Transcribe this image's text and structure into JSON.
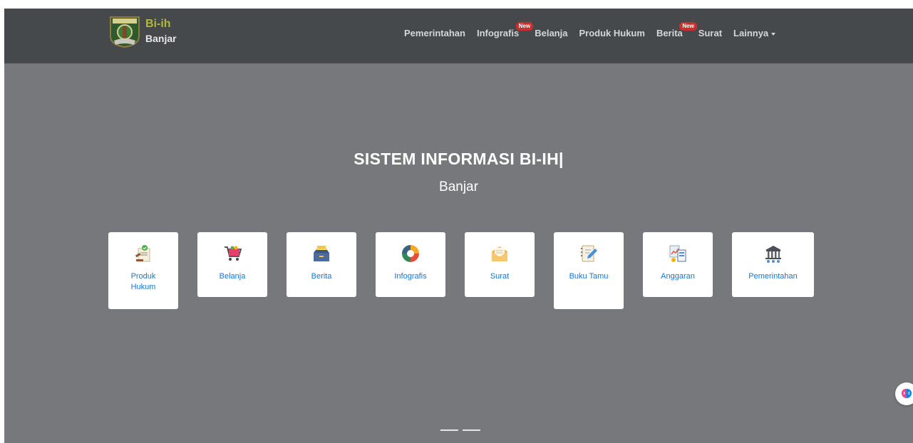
{
  "brand": {
    "name": "Bi-ih",
    "subtitle": "Banjar"
  },
  "nav": {
    "items": [
      {
        "label": "Pemerintahan"
      },
      {
        "label": "Infografis",
        "badge": "New"
      },
      {
        "label": "Belanja"
      },
      {
        "label": "Produk Hukum"
      },
      {
        "label": "Berita",
        "badge": "New"
      },
      {
        "label": "Surat"
      },
      {
        "label": "Lainnya"
      }
    ]
  },
  "hero": {
    "title": "SISTEM INFORMASI BI-IH|",
    "subtitle": "Banjar"
  },
  "cards": [
    {
      "label": "Produk Hukum",
      "icon": "law-document-icon"
    },
    {
      "label": "Belanja",
      "icon": "shopping-cart-icon"
    },
    {
      "label": "Berita",
      "icon": "news-inbox-icon"
    },
    {
      "label": "Infografis",
      "icon": "pie-chart-icon"
    },
    {
      "label": "Surat",
      "icon": "envelope-icon"
    },
    {
      "label": "Buku Tamu",
      "icon": "guestbook-icon"
    },
    {
      "label": "Anggaran",
      "icon": "budget-chart-icon"
    },
    {
      "label": "Pemerintahan",
      "icon": "government-building-icon"
    }
  ],
  "colors": {
    "accent_link": "#1a74d4",
    "brand_green": "#b1b83a",
    "badge_red": "#c9302c"
  }
}
